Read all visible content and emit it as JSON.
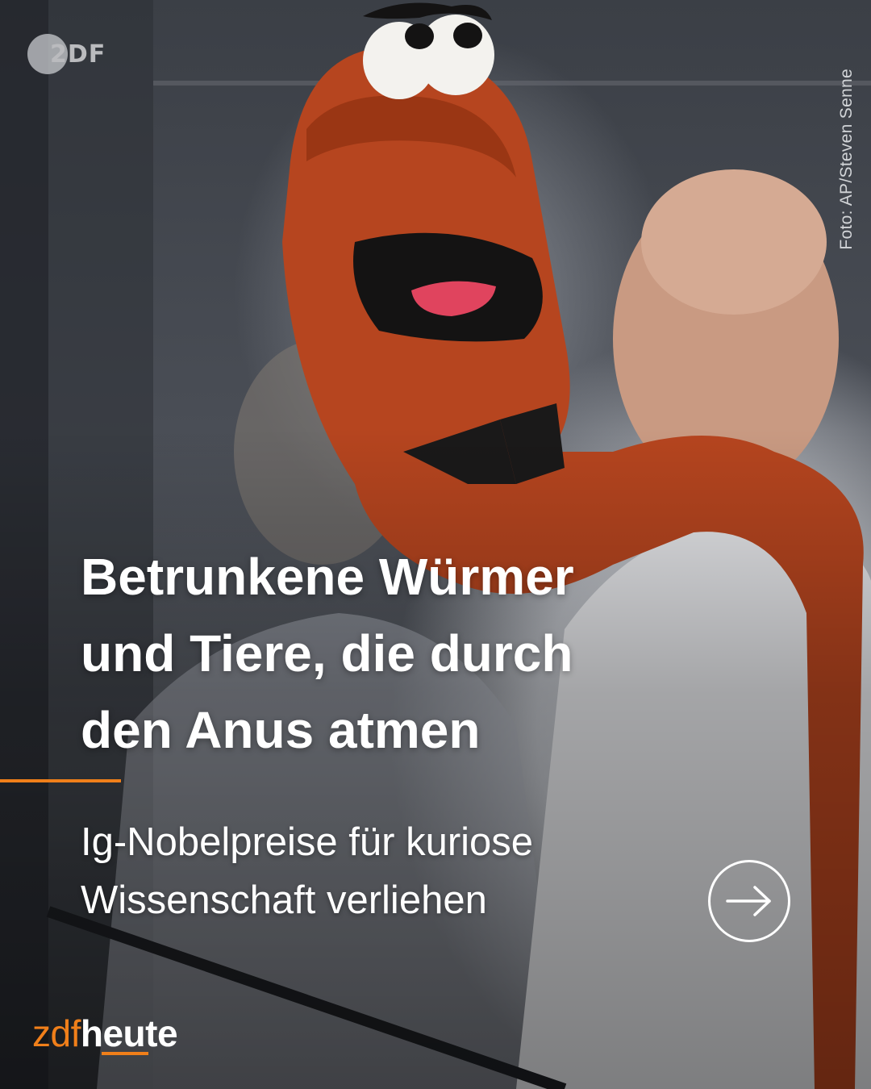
{
  "post": {
    "headline_lines": [
      "Betrunkene Würmer",
      "und Tiere, die durch",
      "den Anus atmen"
    ],
    "subline_lines": [
      "Ig-Nobelpreise für kuriose",
      "Wissenschaft verliehen"
    ],
    "photo_credit": "Foto: AP/Steven Senne",
    "channel_logo": "2DF",
    "brand": {
      "prefix": "zdf",
      "suffix": "heute"
    },
    "next_button_icon": "arrow-right-circle-icon"
  },
  "colors": {
    "accent": "#f07f1a",
    "text": "#ffffff"
  }
}
